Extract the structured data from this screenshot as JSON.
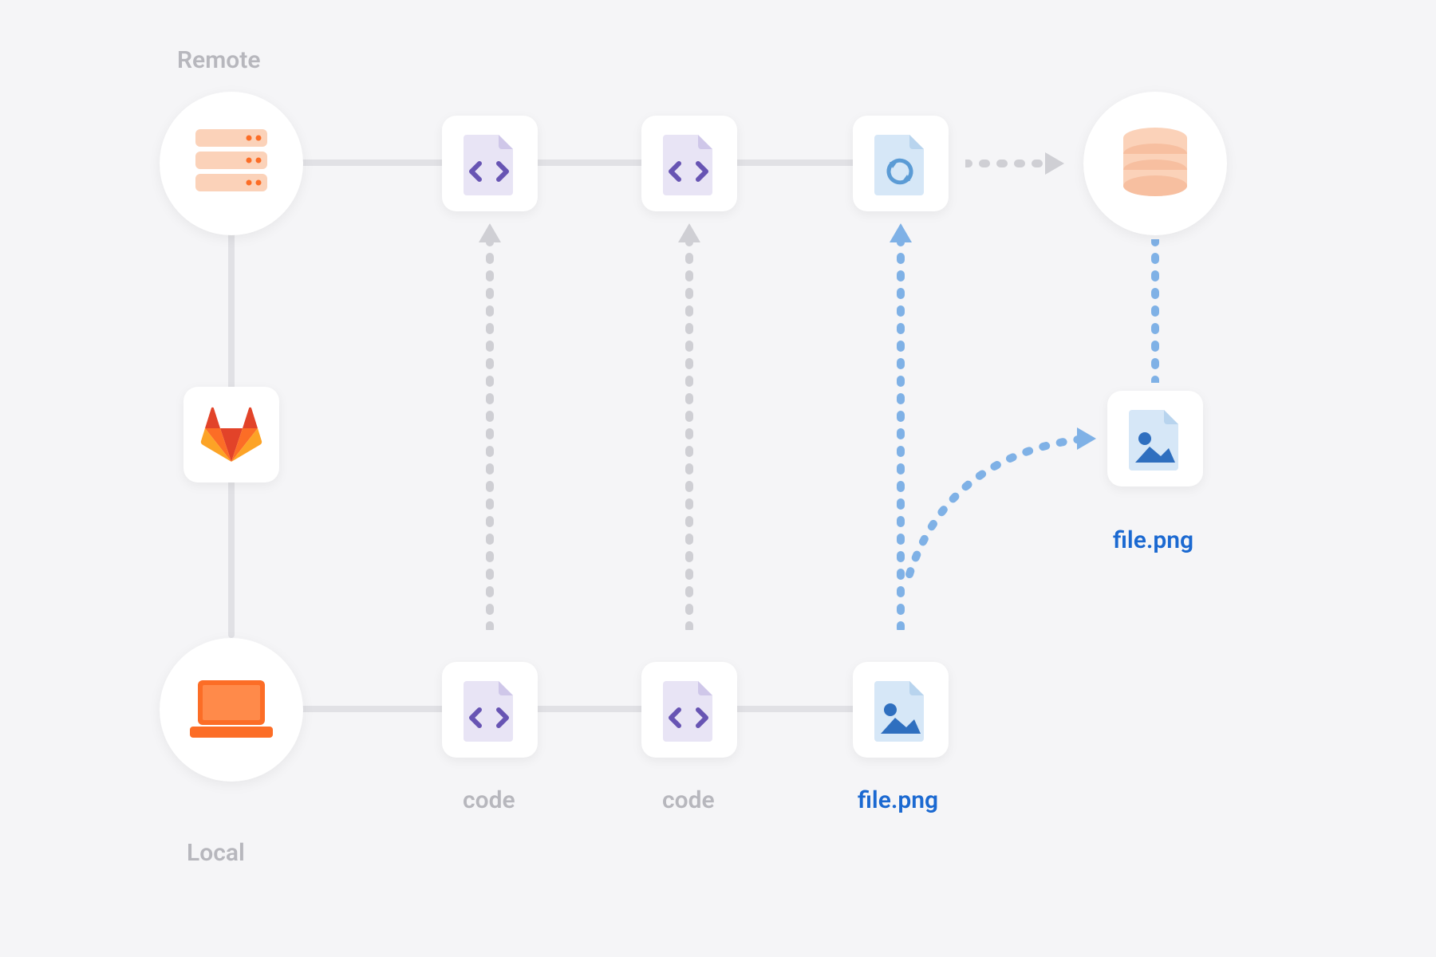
{
  "labels": {
    "remote": "Remote",
    "local": "Local",
    "code1": "code",
    "code2": "code",
    "file_local": "file.png",
    "file_remote": "file.png"
  },
  "colors": {
    "grey_text": "#b7b7bd",
    "blue_text": "#1b69d1",
    "connector": "#e1e1e5",
    "dashed_grey": "#cfcfd4",
    "dashed_blue": "#7fb1e6",
    "orange": "#fc6d26",
    "orange_light": "#fbd2b9",
    "purple": "#6754b3",
    "purple_light": "#e8e4f5",
    "blue_light": "#d6e7f7",
    "blue_mid": "#5b9bd5"
  },
  "nodes": {
    "server": "remote-server",
    "laptop": "local-laptop",
    "gitlab": "gitlab-logo",
    "database": "remote-database",
    "remote_code_1": "code-file",
    "remote_code_2": "code-file",
    "remote_sync": "sync-file",
    "local_code_1": "code-file",
    "local_code_2": "code-file",
    "local_image": "image-file-png",
    "remote_image": "image-file-png"
  }
}
